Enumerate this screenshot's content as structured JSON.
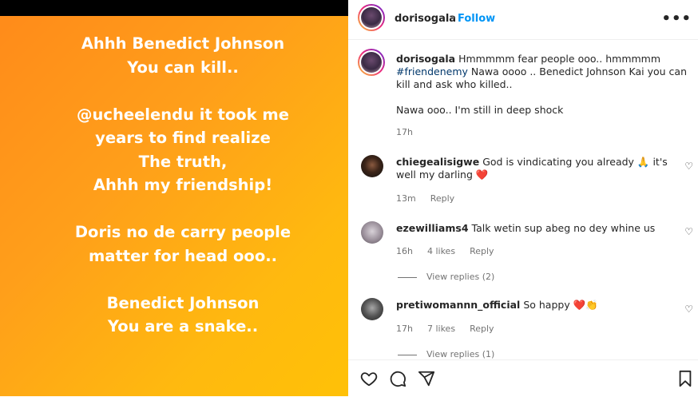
{
  "story": {
    "lines": [
      "Ahhh Benedict Johnson",
      "You can kill..",
      "",
      "@ucheelendu it took me",
      "years to find realize",
      "The truth,",
      "Ahhh my friendship!",
      "",
      "Doris no de carry people",
      "matter for head ooo..",
      "",
      "Benedict Johnson",
      "You are a snake.."
    ]
  },
  "header": {
    "username": "dorisogala",
    "dot": "•",
    "follow_label": "Follow",
    "more_icon": "more-horizontal-icon"
  },
  "caption": {
    "username": "dorisogala",
    "text_1": "Hmmmmm fear people ooo.. hmmmmm",
    "hashtag": "#friendenemy",
    "text_2": "Nawa oooo .. Benedict Johnson Kai you can kill and ask who killed..",
    "text_3": "Nawa ooo.. I'm still in deep shock",
    "time": "17h"
  },
  "comments": [
    {
      "username": "chiegealisigwe",
      "text": "God is vindicating you already 🙏 it's well my darling ❤️",
      "time": "13m",
      "likes": "",
      "reply": "Reply"
    },
    {
      "username": "ezewilliams4",
      "text": "Talk wetin sup abeg no dey whine us",
      "time": "16h",
      "likes": "4 likes",
      "reply": "Reply",
      "view_replies": "View replies (2)"
    },
    {
      "username": "pretiwomannn_official",
      "text": "So happy ❤️👏",
      "time": "17h",
      "likes": "7 likes",
      "reply": "Reply",
      "view_replies": "View replies (1)"
    }
  ],
  "actions": {
    "like_icon": "heart-icon",
    "comment_icon": "comment-icon",
    "share_icon": "send-icon",
    "save_icon": "bookmark-icon"
  }
}
